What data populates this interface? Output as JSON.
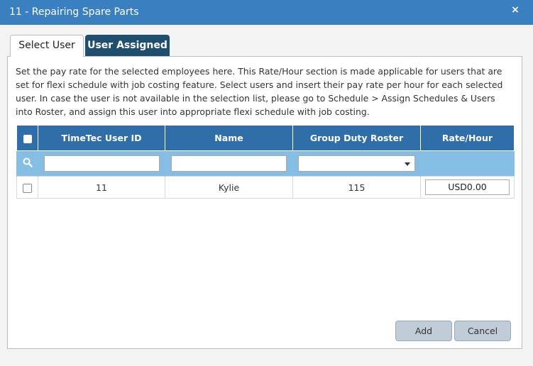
{
  "window": {
    "title": "11 - Repairing Spare Parts",
    "close_glyph": "×"
  },
  "tabs": [
    {
      "label": "Select User",
      "active": true
    },
    {
      "label": "User Assigned",
      "active": false
    }
  ],
  "description": "Set the pay rate for the selected employees here. This Rate/Hour section is made applicable for users that are set for flexi schedule with job costing feature. Select users and insert their pay rate per hour for each selected user. In case the user is not available in the selection list, please go to Schedule > Assign Schedules & Users into Roster, and assign this user into appropriate flexi schedule with job costing.",
  "table": {
    "headers": [
      "TimeTec User ID",
      "Name",
      "Group Duty Roster",
      "Rate/Hour"
    ],
    "filters": {
      "user_id": "",
      "name": "",
      "group_duty_roster": ""
    },
    "rows": [
      {
        "user_id": "11",
        "name": "Kylie",
        "group_duty_roster": "115",
        "rate": "USD0.00",
        "checked": false
      }
    ]
  },
  "buttons": {
    "add": "Add",
    "cancel": "Cancel"
  },
  "colors": {
    "titlebar": "#3a7fbf",
    "table_header": "#2f6ea8",
    "filter_row": "#86bde4",
    "active_tab_dark": "#1f4e6e",
    "button": "#c0ccd8"
  }
}
